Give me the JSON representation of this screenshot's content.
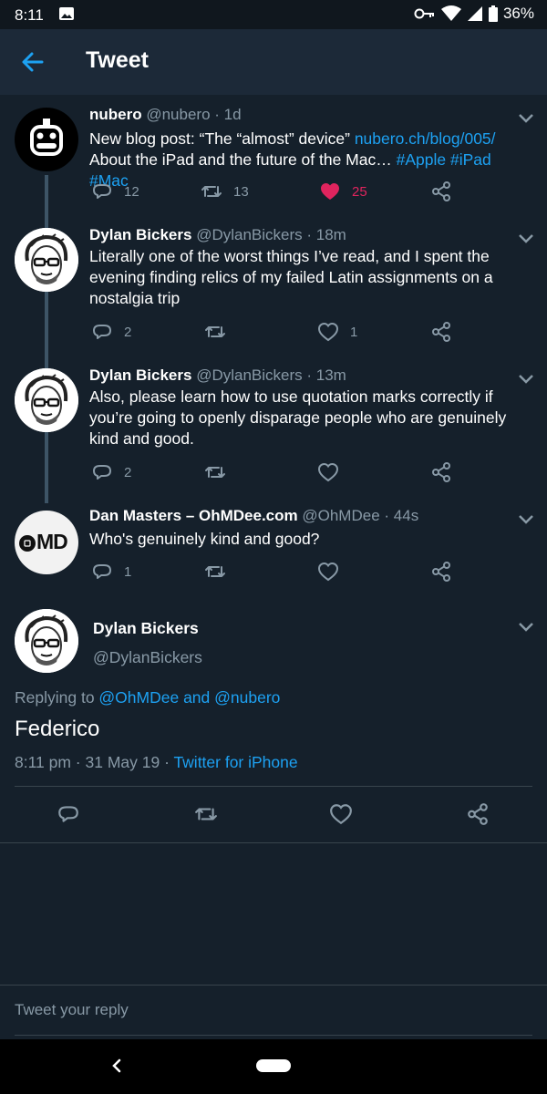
{
  "status": {
    "time": "8:11",
    "battery": "36%"
  },
  "header": {
    "title": "Tweet"
  },
  "tweets": [
    {
      "name": "nubero",
      "handle": "@nubero",
      "age": "· 1d",
      "text_a": "New blog post: “The “almost” device” ",
      "link": "nubero.ch/blog/005/",
      "text_b": "About the iPad and the future of the Mac… ",
      "tags": "#Apple #iPad #Mac",
      "replies": "12",
      "retweets": "13",
      "likes": "25"
    },
    {
      "name": "Dylan Bickers",
      "handle": "@DylanBickers",
      "age": "· 18m",
      "text": "Literally one of the worst things I’ve read, and I spent the evening finding relics of my failed Latin assignments on a nostalgia trip",
      "replies": "2",
      "likes": "1"
    },
    {
      "name": "Dylan Bickers",
      "handle": "@DylanBickers",
      "age": "· 13m",
      "text": "Also, please learn how to use quotation marks correctly if you’re going to openly disparage people who are genuinely kind and good.",
      "replies": "2"
    },
    {
      "name": "Dan Masters – OhMDee.com",
      "handle": "@OhMDee",
      "age": "· 44s",
      "text": "Who's genuinely kind and good?",
      "replies": "1",
      "avatar_text": "MD"
    }
  ],
  "main": {
    "name": "Dylan Bickers",
    "handle": "@DylanBickers",
    "replying_prefix": "Replying to ",
    "replying_to": "@OhMDee and @nubero",
    "text": "Federico",
    "timestamp": "8:11 pm · 31 May 19 · ",
    "source": "Twitter for iPhone"
  },
  "reply": {
    "placeholder": "Tweet your reply"
  },
  "colors": {
    "background": "#15202b",
    "accent": "#1da1f2",
    "like": "#e0245e",
    "muted": "#8899a6"
  }
}
